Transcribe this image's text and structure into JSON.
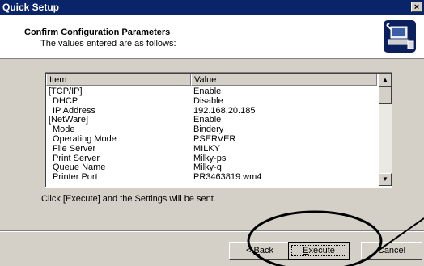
{
  "window": {
    "title": "Quick Setup",
    "close_glyph": "×"
  },
  "header": {
    "title": "Confirm Configuration Parameters",
    "subtitle": "The values entered are as follows:"
  },
  "list": {
    "columns": [
      "Item",
      "Value"
    ],
    "rows": [
      {
        "item": "[TCP/IP]",
        "value": "Enable",
        "indent": false
      },
      {
        "item": "DHCP",
        "value": "Disable",
        "indent": true
      },
      {
        "item": "IP Address",
        "value": "192.168.20.185",
        "indent": true
      },
      {
        "item": "[NetWare]",
        "value": "Enable",
        "indent": false
      },
      {
        "item": "Mode",
        "value": "Bindery",
        "indent": true
      },
      {
        "item": "Operating Mode",
        "value": "PSERVER",
        "indent": true
      },
      {
        "item": "File Server",
        "value": "MILKY",
        "indent": true
      },
      {
        "item": "Print Server",
        "value": "Milky-ps",
        "indent": true
      },
      {
        "item": "Queue Name",
        "value": "Milky-q",
        "indent": true
      },
      {
        "item": "Printer Port",
        "value": "PR3463819 wm4",
        "indent": true
      }
    ],
    "scroll_up_glyph": "▲",
    "scroll_down_glyph": "▼"
  },
  "hint": "Click [Execute] and the Settings will be sent.",
  "buttons": {
    "back_prefix": "< ",
    "back_mnemonic": "B",
    "back_rest": "ack",
    "execute_mnemonic": "E",
    "execute_rest": "xecute",
    "cancel": "Cancel"
  },
  "icons": {
    "header": "wizard-computer-icon",
    "close": "close-icon"
  },
  "colors": {
    "titlebar": "#0a246a",
    "dialog": "#d4d0c8",
    "header_bg": "#ffffff"
  }
}
